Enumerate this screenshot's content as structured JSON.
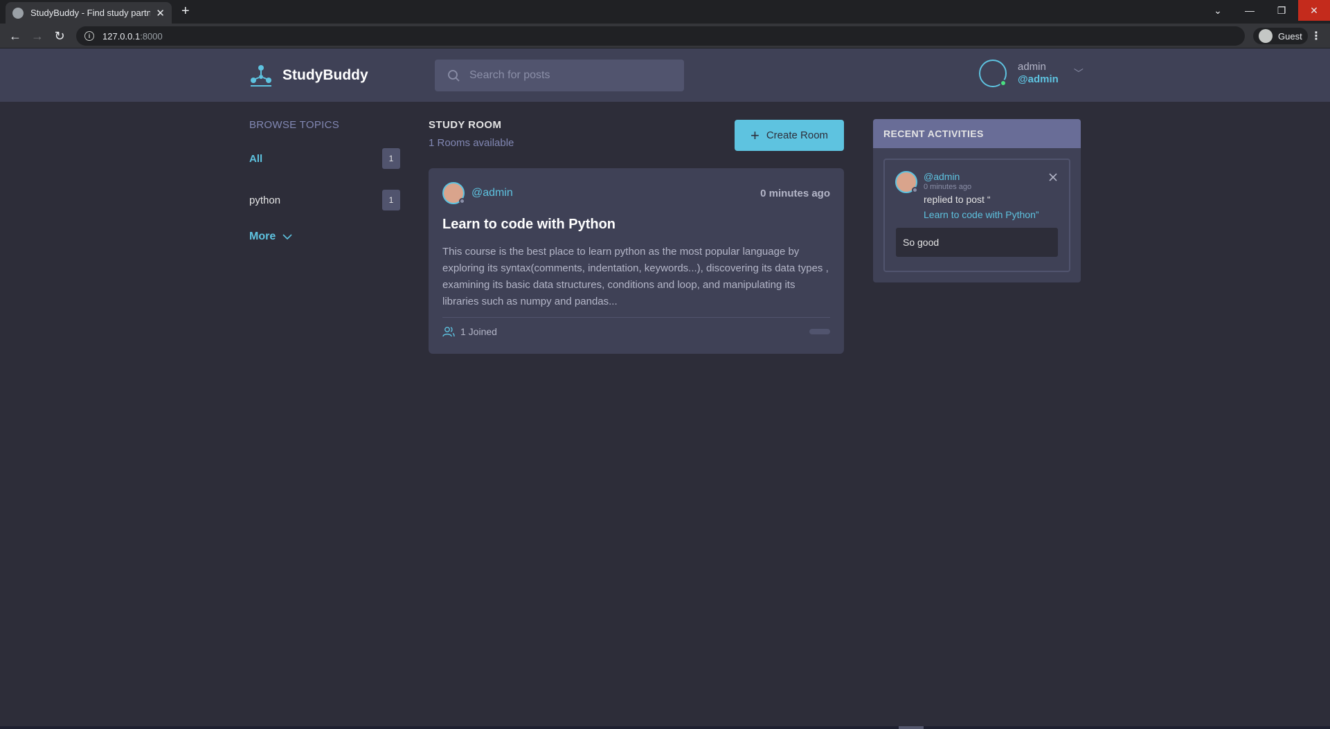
{
  "browser": {
    "tab_title": "StudyBuddy - Find study partners",
    "url_host": "127.0.0.1",
    "url_port": ":8000",
    "profile_label": "Guest"
  },
  "header": {
    "brand": "StudyBuddy",
    "search_placeholder": "Search for posts",
    "user_name": "admin",
    "user_handle": "@admin"
  },
  "topics": {
    "title": "BROWSE TOPICS",
    "items": [
      {
        "label": "All",
        "count": "1"
      },
      {
        "label": "python",
        "count": "1"
      }
    ],
    "more_label": "More"
  },
  "feed": {
    "title": "STUDY ROOM",
    "count_text": "1 Rooms available",
    "create_label": "Create Room",
    "rooms": [
      {
        "host_handle": "@admin",
        "time": "0 minutes ago",
        "title": "Learn to code with Python",
        "description": "This course is the best place to learn python as the most popular language by exploring its syntax(comments, indentation, keywords...), discovering its data types , examining its basic data structures, conditions and loop, and manipulating its libraries such as numpy and pandas...",
        "joined": "1 Joined"
      }
    ]
  },
  "activity": {
    "title": "RECENT ACTIVITIES",
    "items": [
      {
        "handle": "@admin",
        "time": "0 minutes ago",
        "text": "replied to post “",
        "link": "Learn to code with Python”",
        "reply": "So good"
      }
    ]
  },
  "colors": {
    "accent": "#5ec3e0",
    "background": "#2d2d39",
    "panel": "#3f4156",
    "panel_header": "#696d97"
  }
}
